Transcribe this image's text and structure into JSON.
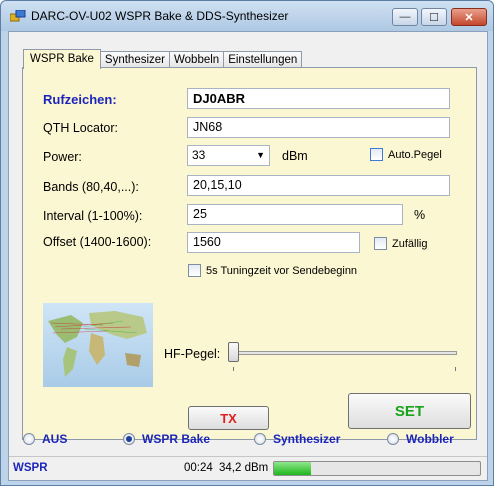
{
  "window": {
    "title": "DARC-OV-U02 WSPR Bake & DDS-Synthesizer",
    "minimize": "—",
    "maximize": "☐",
    "close": "✕"
  },
  "tabs": [
    {
      "label": "WSPR Bake",
      "active": true
    },
    {
      "label": "Synthesizer",
      "active": false
    },
    {
      "label": "Wobbeln",
      "active": false
    },
    {
      "label": "Einstellungen",
      "active": false
    }
  ],
  "form": {
    "callsign_label": "Rufzeichen:",
    "callsign_value": "DJ0ABR",
    "locator_label": "QTH Locator:",
    "locator_value": "JN68",
    "power_label": "Power:",
    "power_value": "33",
    "power_unit": "dBm",
    "autopegel_label": "Auto.Pegel",
    "bands_label": "Bands (80,40,...):",
    "bands_value": "20,15,10",
    "interval_label": "Interval (1-100%):",
    "interval_value": "25",
    "interval_unit": "%",
    "offset_label": "Offset (1400-1600):",
    "offset_value": "1560",
    "random_label": "Zufällig",
    "tuning_label": "5s Tuningzeit vor Sendebeginn",
    "hf_label": "HF-Pegel:",
    "tx_button": "TX",
    "set_button": "SET"
  },
  "modes": [
    {
      "label": "AUS",
      "selected": false
    },
    {
      "label": "WSPR Bake",
      "selected": true
    },
    {
      "label": "Synthesizer",
      "selected": false
    },
    {
      "label": "Wobbler",
      "selected": false
    }
  ],
  "status": {
    "mode": "WSPR",
    "time": "00:24",
    "power": "34,2 dBm",
    "progress_pct": 18
  },
  "colors": {
    "accent": "#1c25b8",
    "panel": "#fbf7d2",
    "tx": "#e02020",
    "set": "#1aa31a"
  },
  "slider": {
    "hf_level": 0
  }
}
